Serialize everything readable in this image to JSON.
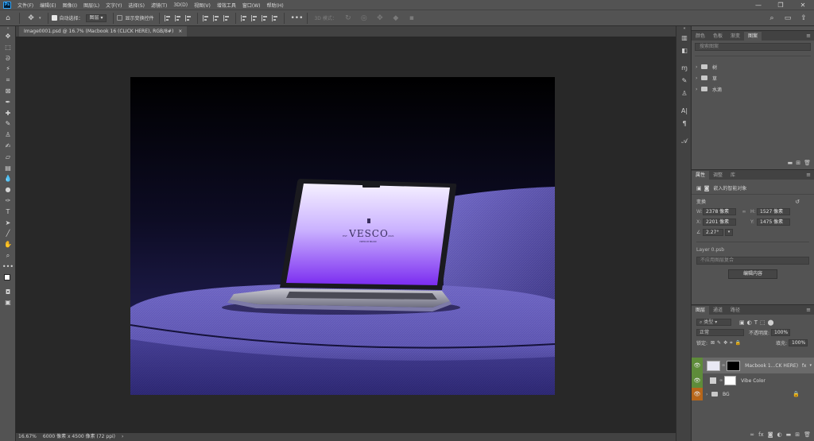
{
  "app": {
    "logo": "Ps"
  },
  "menu": [
    "文件(F)",
    "编辑(E)",
    "图像(I)",
    "图层(L)",
    "文字(Y)",
    "选择(S)",
    "滤镜(T)",
    "3D(D)",
    "视图(V)",
    "增效工具",
    "窗口(W)",
    "帮助(H)"
  ],
  "window_controls": {
    "minimize": "—",
    "restore": "❐",
    "close": "✕"
  },
  "options_bar": {
    "auto_select_label": "自动选择：",
    "auto_select_value": "图层",
    "auto_select_checked": true,
    "show_transform_label": "显示变换控件",
    "show_transform_checked": false,
    "mode_3d_label": "3D 模式："
  },
  "document_tab": {
    "title": "Image0001.psd @ 16.7% (Macbook 16 (CLICK HERE), RGB/8#)",
    "close": "×"
  },
  "status_bar": {
    "zoom": "16.67%",
    "info": "6000 像素 x 4500 像素 (72 ppi)",
    "arrow": "›"
  },
  "artwork": {
    "brand": "VESCO",
    "est_left": "EST",
    "est_right": "2021",
    "tagline": "PREMIUM BRAND"
  },
  "top_panel": {
    "tabs": [
      "颜色",
      "色板",
      "渐变",
      "图案"
    ],
    "active_tab": "图案",
    "search_placeholder": "搜索图案",
    "groups": [
      "树",
      "草",
      "水滴"
    ]
  },
  "properties_panel": {
    "tabs": [
      "属性",
      "调整",
      "库"
    ],
    "active_tab": "属性",
    "object_type": "嵌入的智能对象",
    "transform_label": "变换",
    "w_label": "W:",
    "w_value": "2378 像素",
    "h_label": "H:",
    "h_value": "1527 像素",
    "x_label": "X:",
    "x_value": "2201 像素",
    "y_label": "Y:",
    "y_value": "1475 像素",
    "angle_value": "2.27°",
    "file_name": "Layer 0.psb",
    "comp_placeholder": "不应用图层复合",
    "edit_button": "编辑内容"
  },
  "layers_panel": {
    "tabs": [
      "图层",
      "通道",
      "路径"
    ],
    "active_tab": "图层",
    "filter_label": "类型",
    "blend_mode": "正常",
    "opacity_label": "不透明度:",
    "opacity_value": "100%",
    "lock_label": "锁定:",
    "fill_label": "填充:",
    "fill_value": "100%",
    "layers": [
      {
        "name": "Macbook 1...CK HERE)",
        "fx": "fx",
        "visible": true,
        "selected": true
      },
      {
        "name": "Vibe Color",
        "visible": true
      },
      {
        "name": "BG",
        "visible": true,
        "locked": true
      }
    ]
  },
  "colors": {
    "accent_green": "#5e8c3a",
    "eye_orange": "#b7661a",
    "panel_bg": "#535353",
    "canvas_bg": "#282828",
    "sofa_purple": "#5b4fb0"
  }
}
